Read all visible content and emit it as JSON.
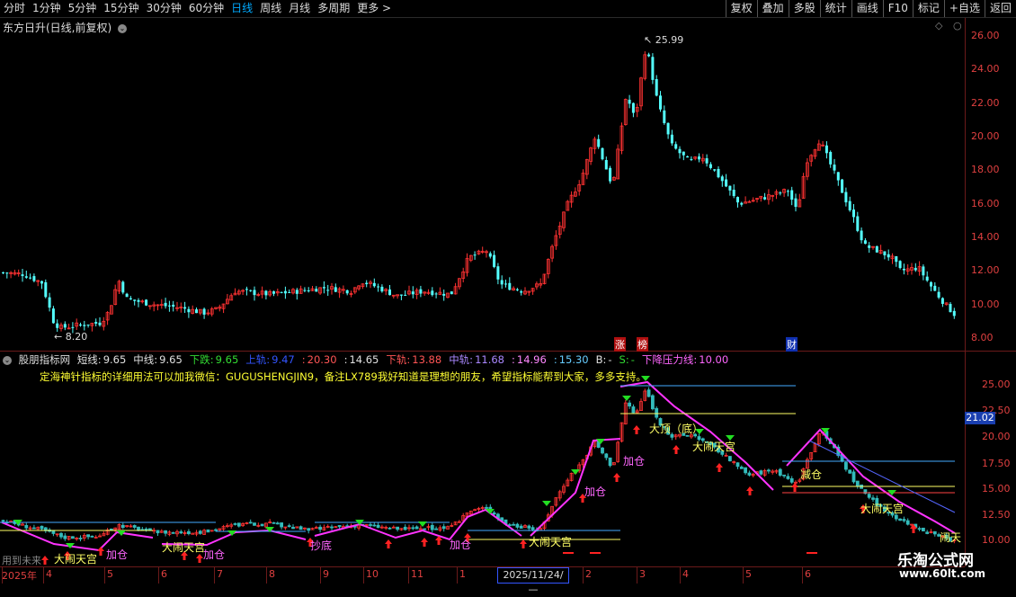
{
  "toolbar": {
    "periods": [
      "分时",
      "1分钟",
      "5分钟",
      "15分钟",
      "30分钟",
      "60分钟",
      "日线",
      "周线",
      "月线",
      "多周期",
      "更多 >"
    ],
    "active_period": "日线",
    "right_buttons": [
      "复权",
      "叠加",
      "多股",
      "统计",
      "画线",
      "F10",
      "标记",
      "+自选",
      "返回"
    ]
  },
  "main_panel": {
    "title": "东方日升(日线,前复权)",
    "high_label": "25.99",
    "low_label": "8.20",
    "y_ticks": [
      "26.00",
      "24.00",
      "22.00",
      "20.00",
      "18.00",
      "16.00",
      "14.00",
      "12.00",
      "10.00",
      "8.00"
    ],
    "event_tags": [
      "涨",
      "榜",
      "财"
    ]
  },
  "indicator_panel": {
    "name": "股朋指标网",
    "values": [
      {
        "label": "短线:",
        "value": "9.65",
        "color": "#e0e0e0"
      },
      {
        "label": "中线:",
        "value": "9.65",
        "color": "#e0e0e0"
      },
      {
        "label": "下跌:",
        "value": "9.65",
        "color": "#33dd33"
      },
      {
        "label": "上轨:",
        "value": "9.47",
        "color": "#3355ff"
      },
      {
        "label": ":",
        "value": "20.30",
        "color": "#ff5555"
      },
      {
        "label": ":",
        "value": "14.65",
        "color": "#e0e0e0"
      },
      {
        "label": "下轨:",
        "value": "13.88",
        "color": "#ff5555"
      },
      {
        "label": "中轨:",
        "value": "11.68",
        "color": "#aa88ff"
      },
      {
        "label": ":",
        "value": "14.96",
        "color": "#ff88ff"
      },
      {
        "label": ":",
        "value": "15.30",
        "color": "#66ccff"
      },
      {
        "label": "B:",
        "value": "-",
        "color": "#e0e0e0"
      },
      {
        "label": "S:",
        "value": "-",
        "color": "#33dd33"
      },
      {
        "label": "下降压力线:",
        "value": "10.00",
        "color": "#ff66ff"
      }
    ],
    "ad_text": "定海神针指标的详细用法可以加我微信：GUGUSHENGJIN9，备注LX789我好知道是理想的朋友，希望指标能帮到大家，多多支持。",
    "y_ticks": [
      "25.00",
      "22.50",
      "20.00",
      "17.50",
      "15.00",
      "12.50",
      "10.00"
    ],
    "current_value": "21.02",
    "signals": [
      {
        "text": "大闹天宫",
        "style": "yellow"
      },
      {
        "text": "加仓",
        "style": "mag"
      },
      {
        "text": "大闹天宫",
        "style": "yellow"
      },
      {
        "text": "加仓",
        "style": "mag"
      },
      {
        "text": "抄底",
        "style": "mag"
      },
      {
        "text": "加仓",
        "style": "mag"
      },
      {
        "text": "大闹天宫",
        "style": "yellow"
      },
      {
        "text": "加仓",
        "style": "mag"
      },
      {
        "text": "加仓",
        "style": "mag"
      },
      {
        "text": "大顶（底）",
        "style": "yellow"
      },
      {
        "text": "大闹天宫",
        "style": "yellow"
      },
      {
        "text": "减仓",
        "style": "yellow"
      },
      {
        "text": "大闹天宫",
        "style": "yellow"
      },
      {
        "text": "闹天",
        "style": "yellow"
      }
    ]
  },
  "x_axis": {
    "labels": [
      "2025年",
      "4",
      "5",
      "6",
      "7",
      "8",
      "9",
      "10",
      "11",
      "1",
      "2",
      "3",
      "4",
      "5",
      "6"
    ],
    "cursor_date": "2025/11/24/—"
  },
  "bottom_hint": "用到未来",
  "watermark": {
    "title": "乐淘公式网",
    "url": "www.60lt.com"
  }
}
